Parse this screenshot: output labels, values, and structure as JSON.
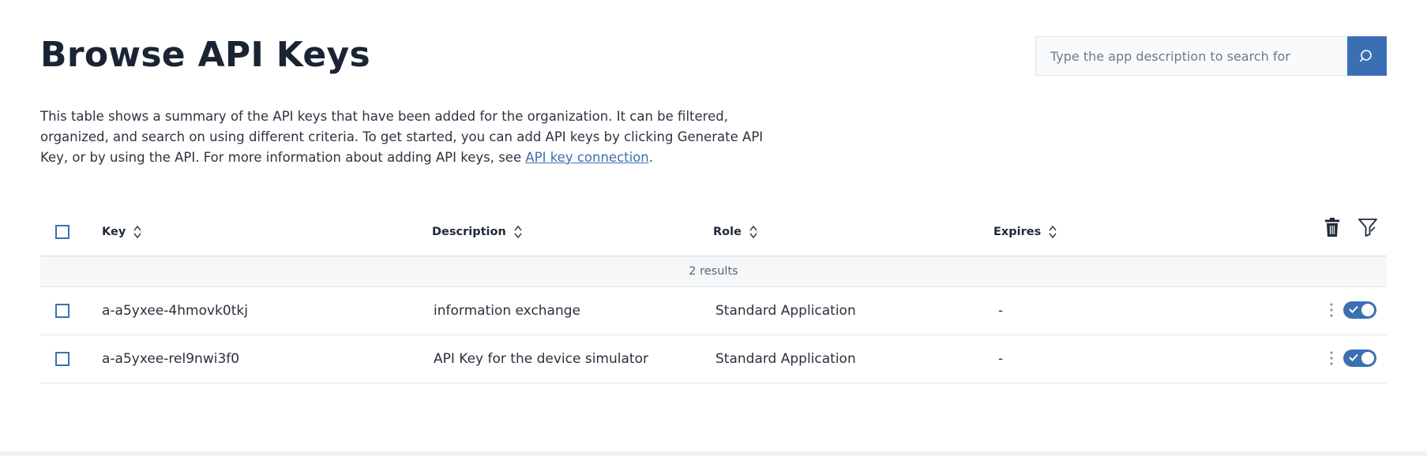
{
  "page": {
    "title": "Browse API Keys",
    "intro_text": "This table shows a summary of the API keys that have been added for the organization. It can be filtered, organized, and search on using different criteria. To get started, you can add API keys by clicking Generate API Key, or by using the API. For more information about adding API keys, see ",
    "intro_link": "API key connection",
    "intro_end": "."
  },
  "search": {
    "placeholder": "Type the app description to search for",
    "value": "",
    "icon": "search-icon"
  },
  "table": {
    "columns": [
      "Key",
      "Description",
      "Role",
      "Expires"
    ],
    "results_label": "2 results",
    "header_actions": [
      "trash-icon",
      "filter-icon"
    ],
    "rows": [
      {
        "key": "a-a5yxee-4hmovk0tkj",
        "description": "information exchange",
        "role": "Standard Application",
        "expires": "-",
        "enabled": true
      },
      {
        "key": "a-a5yxee-rel9nwi3f0",
        "description": "API Key for the device simulator",
        "role": "Standard Application",
        "expires": "-",
        "enabled": true
      }
    ]
  },
  "colors": {
    "accent": "#3d70b2",
    "search_button": "#3b6fb3",
    "text": "#1f2a38",
    "results_bg": "#f5f7f8"
  }
}
